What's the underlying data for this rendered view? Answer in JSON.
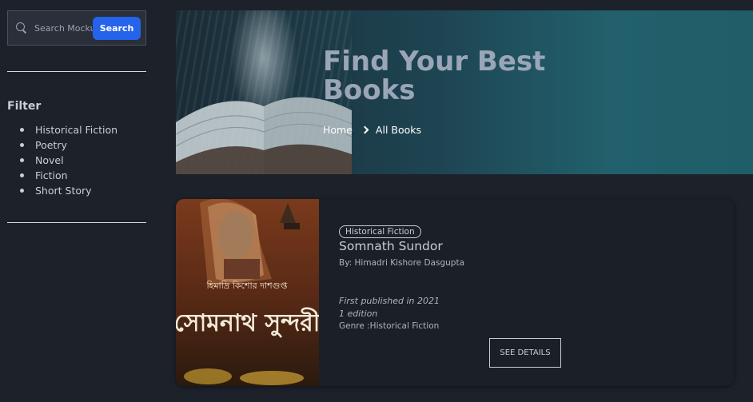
{
  "search": {
    "placeholder": "Search Mockup",
    "button_label": "Search"
  },
  "filter": {
    "title": "Filter",
    "items": [
      "Historical Fiction",
      "Poetry",
      "Novel",
      "Fiction",
      "Short Story"
    ]
  },
  "hero": {
    "title": "Find Your Best Books",
    "breadcrumb": {
      "home": "Home",
      "current": "All Books"
    }
  },
  "book": {
    "genre_badge": "Historical Fiction",
    "title": "Somnath Sundor",
    "author": "By: Himadri Kishore Dasgupta",
    "published": "First published in 2021",
    "edition": "1 edition",
    "genre_line": "Genre :Historical Fiction",
    "details_label": "SEE DETAILS",
    "cover_text_top": "হিমাদ্রি কিশোর দাশগুপ্ত",
    "cover_text_main": "সোমনাথ সুন্দরী"
  },
  "colors": {
    "background": "#1d212a",
    "accent": "#2563eb",
    "hero_title": "#9aa6b8"
  }
}
